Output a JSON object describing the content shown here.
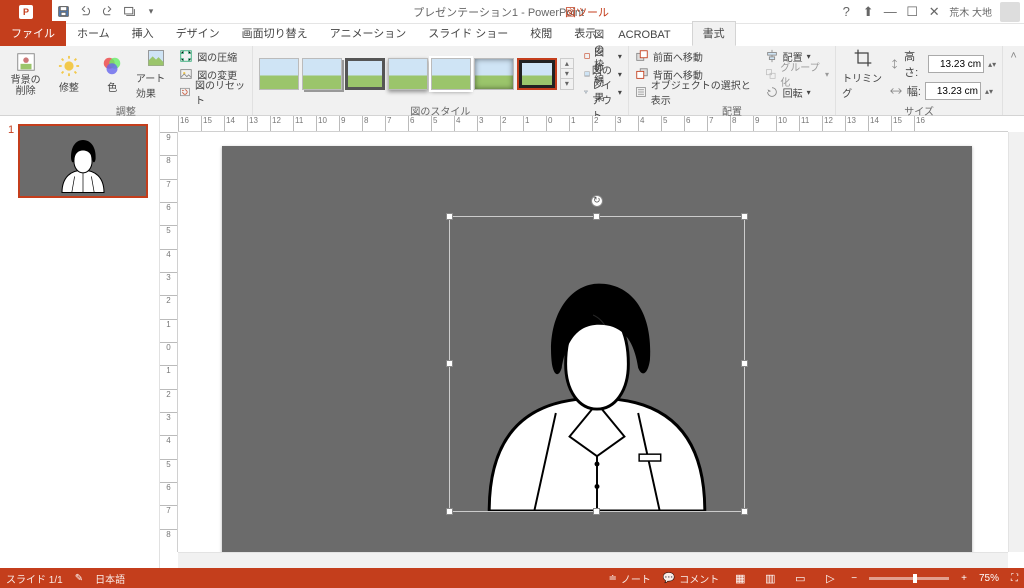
{
  "qat": {
    "title": "プレゼンテーション1 - PowerPoint",
    "tool_context": "図ツール",
    "user": "荒木 大地"
  },
  "window": {
    "help": "?",
    "update": "⬆",
    "min": "—",
    "max": "☐",
    "close": "✕"
  },
  "tabs": {
    "file": "ファイル",
    "home": "ホーム",
    "insert": "挿入",
    "design": "デザイン",
    "transitions": "画面切り替え",
    "animations": "アニメーション",
    "slideshow": "スライド ショー",
    "review": "校閲",
    "view": "表示",
    "acrobat": "ACROBAT",
    "format": "書式"
  },
  "ribbon": {
    "adjust": {
      "remove_bg": "背景の\n削除",
      "corrections": "修整",
      "color": "色",
      "art": "アート効果",
      "compress": "図の圧縮",
      "change": "図の変更",
      "reset": "図のリセット",
      "group": "調整"
    },
    "styles": {
      "group": "図のスタイル",
      "border": "図の枠線",
      "effects": "図の効果",
      "layout": "図のレイアウト"
    },
    "arrange": {
      "forward": "前面へ移動",
      "backward": "背面へ移動",
      "selpane": "オブジェクトの選択と表示",
      "align": "配置",
      "group_btn": "グループ化",
      "rotate": "回転",
      "group": "配置"
    },
    "size": {
      "crop": "トリミング",
      "height_lbl": "高さ:",
      "width_lbl": "幅:",
      "height": "13.23 cm",
      "width": "13.23 cm",
      "group": "サイズ"
    }
  },
  "thumbs": {
    "num": "1"
  },
  "ruler": [
    "16",
    "15",
    "14",
    "13",
    "12",
    "11",
    "10",
    "9",
    "8",
    "7",
    "6",
    "5",
    "4",
    "3",
    "2",
    "1",
    "0",
    "1",
    "2",
    "3",
    "4",
    "5",
    "6",
    "7",
    "8",
    "9",
    "10",
    "11",
    "12",
    "13",
    "14",
    "15",
    "16"
  ],
  "vruler": [
    "9",
    "8",
    "7",
    "6",
    "5",
    "4",
    "3",
    "2",
    "1",
    "0",
    "1",
    "2",
    "3",
    "4",
    "5",
    "6",
    "7",
    "8"
  ],
  "status": {
    "page": "スライド 1/1",
    "lang": "日本語",
    "notes": "ノート",
    "comments": "コメント",
    "zoom_minus": "−",
    "zoom_plus": "+",
    "zoom": "75%",
    "fit": "⛶"
  }
}
